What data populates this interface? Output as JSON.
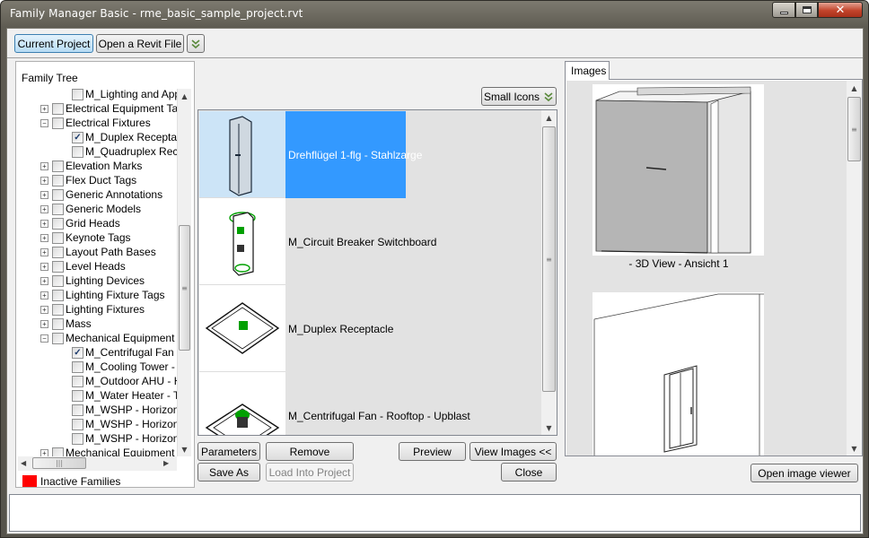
{
  "window": {
    "title": "Family Manager Basic -  rme_basic_sample_project.rvt",
    "min_icon": "minimize-icon",
    "max_icon": "maximize-icon",
    "close_icon": "close-icon"
  },
  "toolbar": {
    "current_project": "Current Project",
    "open_revit_file": "Open a Revit File",
    "expand_icon": "double-chevron-down-icon"
  },
  "family_tree": {
    "label": "Family Tree",
    "rows": [
      {
        "label": "M_Lighting and App",
        "level": 2,
        "expander": "",
        "checked": false
      },
      {
        "label": "Electrical Equipment Tag",
        "level": 1,
        "expander": "+",
        "checked": false
      },
      {
        "label": "Electrical Fixtures",
        "level": 1,
        "expander": "−",
        "checked": false
      },
      {
        "label": "M_Duplex Receptac",
        "level": 2,
        "expander": "",
        "checked": true
      },
      {
        "label": "M_Quadruplex Rece",
        "level": 2,
        "expander": "",
        "checked": false
      },
      {
        "label": "Elevation Marks",
        "level": 1,
        "expander": "+",
        "checked": false
      },
      {
        "label": "Flex Duct Tags",
        "level": 1,
        "expander": "+",
        "checked": false
      },
      {
        "label": "Generic Annotations",
        "level": 1,
        "expander": "+",
        "checked": false
      },
      {
        "label": "Generic Models",
        "level": 1,
        "expander": "+",
        "checked": false
      },
      {
        "label": "Grid Heads",
        "level": 1,
        "expander": "+",
        "checked": false
      },
      {
        "label": "Keynote Tags",
        "level": 1,
        "expander": "+",
        "checked": false
      },
      {
        "label": "Layout Path Bases",
        "level": 1,
        "expander": "+",
        "checked": false
      },
      {
        "label": "Level Heads",
        "level": 1,
        "expander": "+",
        "checked": false
      },
      {
        "label": "Lighting Devices",
        "level": 1,
        "expander": "+",
        "checked": false
      },
      {
        "label": "Lighting Fixture Tags",
        "level": 1,
        "expander": "+",
        "checked": false
      },
      {
        "label": "Lighting Fixtures",
        "level": 1,
        "expander": "+",
        "checked": false
      },
      {
        "label": "Mass",
        "level": 1,
        "expander": "+",
        "checked": false
      },
      {
        "label": "Mechanical Equipment",
        "level": 1,
        "expander": "−",
        "checked": false
      },
      {
        "label": "M_Centrifugal Fan - ",
        "level": 2,
        "expander": "",
        "checked": true
      },
      {
        "label": "M_Cooling Tower - C",
        "level": 2,
        "expander": "",
        "checked": false
      },
      {
        "label": "M_Outdoor AHU - H",
        "level": 2,
        "expander": "",
        "checked": false
      },
      {
        "label": "M_Water Heater - T",
        "level": 2,
        "expander": "",
        "checked": false
      },
      {
        "label": "M_WSHP - Horizont",
        "level": 2,
        "expander": "",
        "checked": false
      },
      {
        "label": "M_WSHP - Horizont",
        "level": 2,
        "expander": "",
        "checked": false
      },
      {
        "label": "M_WSHP - Horizont",
        "level": 2,
        "expander": "",
        "checked": false
      },
      {
        "label": "Mechanical Equipment T",
        "level": 1,
        "expander": "+",
        "checked": false
      }
    ],
    "legend_color": "#ff0000",
    "legend_label": "Inactive Families"
  },
  "view_mode": {
    "label": "Small Icons"
  },
  "families": [
    {
      "name": "Drehflügel 1-flg - Stahlzarge",
      "selected": true
    },
    {
      "name": "M_Circuit Breaker Switchboard",
      "selected": false
    },
    {
      "name": "M_Duplex Receptacle",
      "selected": false
    },
    {
      "name": "M_Centrifugal Fan -  Rooftop  - Upblast",
      "selected": false
    }
  ],
  "buttons": {
    "parameters": "Parameters",
    "remove": "Remove",
    "preview": "Preview",
    "view_images": "View Images <<",
    "save_as": "Save As",
    "load_into_project": "Load Into Project",
    "close": "Close",
    "open_image_viewer": "Open image viewer"
  },
  "images_panel": {
    "tab": "Images",
    "captions": [
      "- 3D View - Ansicht 1",
      ""
    ]
  },
  "colors": {
    "selection": "#3399ff",
    "accent_green": "#00a000"
  }
}
